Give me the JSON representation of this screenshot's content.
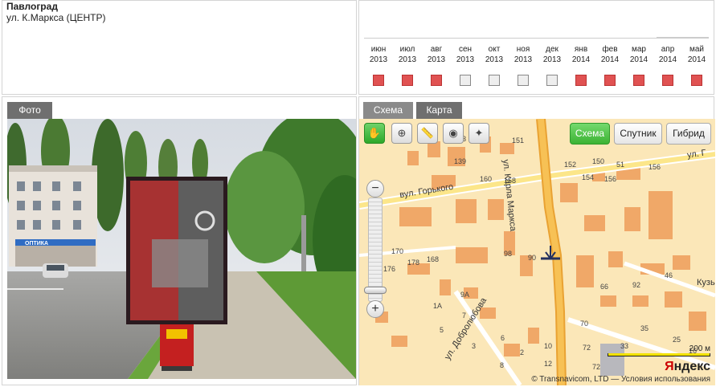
{
  "info": {
    "city": "Павлоград",
    "address": "ул. К.Маркса (ЦЕНТР)"
  },
  "calendar": {
    "months": [
      {
        "m": "июн",
        "y": "2013",
        "status": "busy"
      },
      {
        "m": "июл",
        "y": "2013",
        "status": "busy"
      },
      {
        "m": "авг",
        "y": "2013",
        "status": "busy"
      },
      {
        "m": "сен",
        "y": "2013",
        "status": "free"
      },
      {
        "m": "окт",
        "y": "2013",
        "status": "free"
      },
      {
        "m": "ноя",
        "y": "2013",
        "status": "free"
      },
      {
        "m": "дек",
        "y": "2013",
        "status": "free"
      },
      {
        "m": "янв",
        "y": "2014",
        "status": "busy"
      },
      {
        "m": "фев",
        "y": "2014",
        "status": "busy"
      },
      {
        "m": "мар",
        "y": "2014",
        "status": "busy"
      },
      {
        "m": "апр",
        "y": "2014",
        "status": "busy"
      },
      {
        "m": "май",
        "y": "2014",
        "status": "busy"
      }
    ],
    "colors": {
      "busy": "#e05252",
      "free": "#eeeeee"
    }
  },
  "photo": {
    "tab_label": "Фото",
    "shop_sign": "ОПТИКА"
  },
  "map": {
    "tabs": {
      "scheme": "Схема",
      "map": "Карта"
    },
    "tools": [
      {
        "name": "hand-tool-icon",
        "glyph": "✋"
      },
      {
        "name": "zoom-area-icon",
        "glyph": "⊕"
      },
      {
        "name": "ruler-icon",
        "glyph": "📏"
      },
      {
        "name": "magnifier-icon",
        "glyph": "◉"
      },
      {
        "name": "reset-view-icon",
        "glyph": "✦"
      }
    ],
    "types": {
      "scheme": "Схема",
      "satellite": "Спутник",
      "hybrid": "Гибрид"
    },
    "streets": {
      "gorkogo": "вул. Горького",
      "marxa": "ул. Карла Маркса",
      "gl": "ул. Г",
      "dobroliubova": "ул. Добролюбова",
      "kuz": "Кузь"
    },
    "house_numbers": [
      "153",
      "151",
      "139",
      "152",
      "150",
      "156",
      "154",
      "156",
      "170",
      "176",
      "178",
      "168",
      "98",
      "90",
      "66",
      "92",
      "72",
      "9A",
      "7",
      "1A",
      "5",
      "6",
      "3",
      "2",
      "8",
      "70",
      "33",
      "35",
      "25",
      "16",
      "158",
      "160",
      "72",
      "46",
      "51",
      "12",
      "10"
    ],
    "scale": "200 м",
    "logo_red": "Я",
    "logo_black": "ндекс",
    "copyright": "© Transnavicom, LTD — Условия использования"
  }
}
